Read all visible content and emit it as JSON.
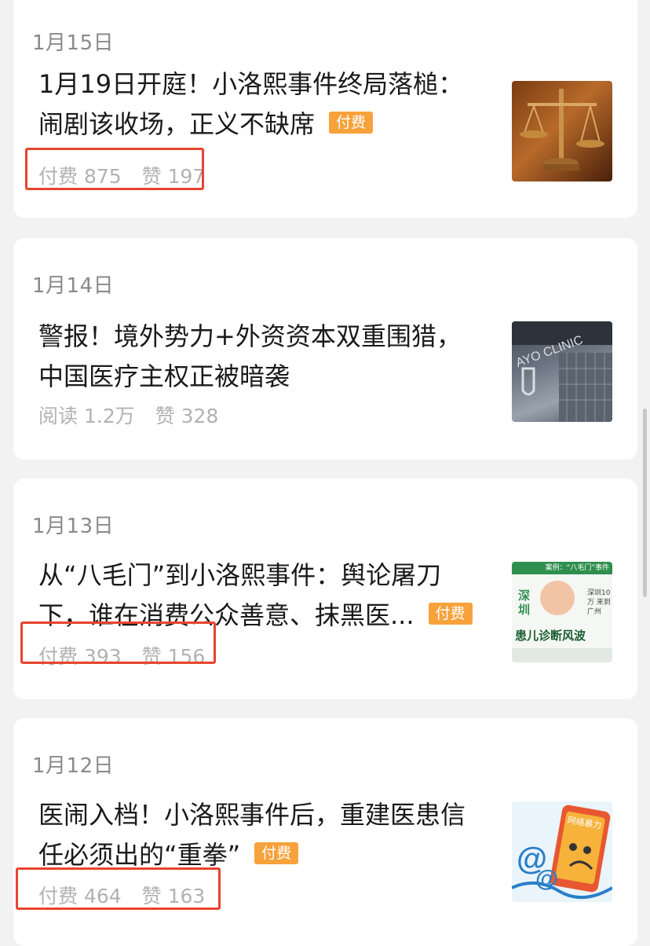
{
  "articles": [
    {
      "date": "1月15日",
      "title_line1": "1月19日开庭！小洛熙事件终局落槌：",
      "title_line2": "闹剧该收场，正义不缺席",
      "tag": "付费",
      "stat1_label": "付费",
      "stat1_value": "875",
      "stat2_label": "赞",
      "stat2_value": "197",
      "thumb_icon": "scales-of-justice-image"
    },
    {
      "date": "1月14日",
      "title_line1": "警报！境外势力+外资资本双重围猎，",
      "title_line2": "中国医疗主权正被暗袭",
      "tag": "",
      "stat1_label": "阅读",
      "stat1_value": "1.2万",
      "stat2_label": "赞",
      "stat2_value": "328",
      "thumb_icon": "clinic-building-image",
      "thumb_text": "AYO CLINIC"
    },
    {
      "date": "1月13日",
      "title_line1": "从“八毛门”到小洛熙事件：舆论屠刀",
      "title_line2": "下，谁在消费公众善意、抹黑医...",
      "tag": "付费",
      "stat1_label": "付费",
      "stat1_value": "393",
      "stat2_label": "赞",
      "stat2_value": "156",
      "thumb_icon": "news-clipping-image",
      "thumb_header": "案例：“八毛门”事件",
      "thumb_city": "深圳",
      "thumb_caption": "患儿诊断风波",
      "thumb_side": "深圳10万 来到广州"
    },
    {
      "date": "1月12日",
      "title_line1": "医闹入档！小洛熙事件后，重建医患信",
      "title_line2": "任必须出的“重拳”",
      "tag": "付费",
      "stat1_label": "付费",
      "stat1_value": "464",
      "stat2_label": "赞",
      "stat2_value": "163",
      "thumb_icon": "online-abuse-cartoon-image",
      "thumb_text": "网络暴力"
    }
  ],
  "colors": {
    "background": "#f2f2f2",
    "card": "#ffffff",
    "paid_tag": "#f7a23b",
    "highlight": "#e8442e",
    "meta_text": "#b2b2b2"
  }
}
